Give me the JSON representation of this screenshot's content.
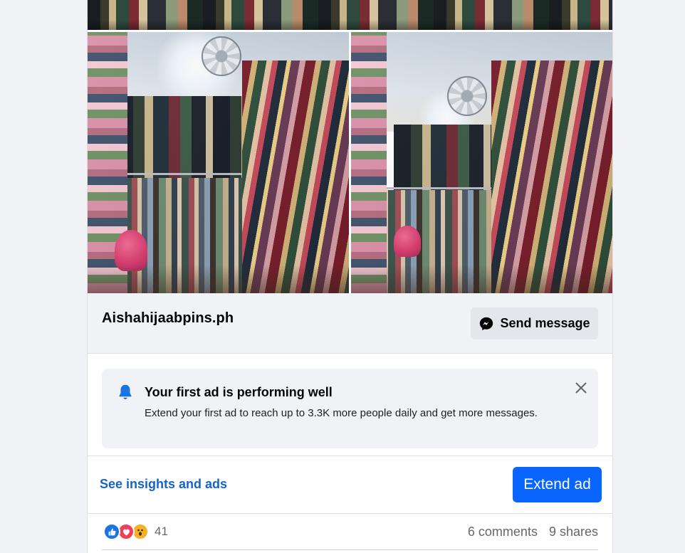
{
  "post": {
    "photos": [
      {
        "name": "shop-photo-top",
        "subject": "clothing rack"
      },
      {
        "name": "shop-photo-left",
        "subject": "clothing shop interior"
      },
      {
        "name": "shop-photo-right",
        "subject": "clothing shop interior"
      }
    ]
  },
  "ad_footer": {
    "page_name": "Aishahijaabpins.ph",
    "send_button": {
      "label": "Send message",
      "icon": "messenger-icon"
    }
  },
  "notice": {
    "icon": "bell-icon",
    "title": "Your first ad is performing well",
    "body": "Extend your first ad to reach up to 3.3K more people daily and get more messages.",
    "close_icon": "close-icon"
  },
  "actions": {
    "insights_link": "See insights and ads",
    "extend_button": "Extend ad"
  },
  "engagement": {
    "reactions": [
      "like-icon",
      "love-icon",
      "wow-icon"
    ],
    "reaction_count": "41",
    "comments": "6 comments",
    "shares": "9 shares"
  },
  "colors": {
    "primary_blue": "#0866ff",
    "link_blue": "#1664c6",
    "page_bg": "#f0f2f5",
    "secondary_text": "#65676b"
  }
}
